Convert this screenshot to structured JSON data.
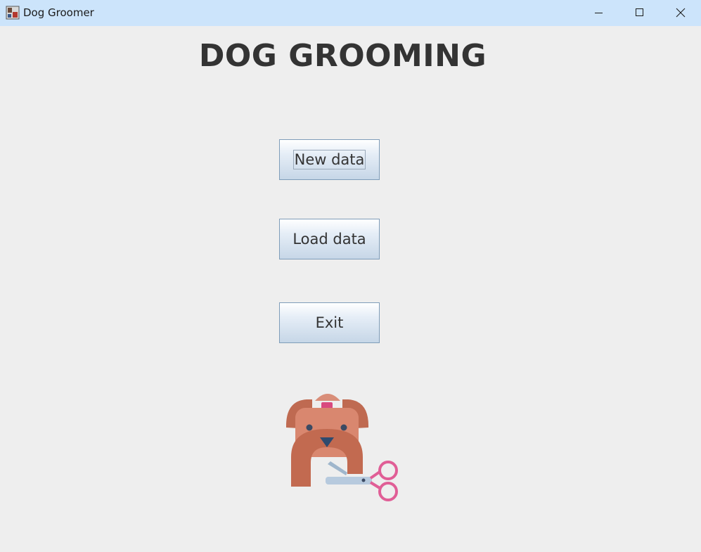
{
  "window": {
    "title": "Dog Groomer",
    "icons": {
      "app": "app-icon",
      "minimize": "minimize-icon",
      "maximize": "maximize-icon",
      "close": "close-icon"
    }
  },
  "main": {
    "heading": "DOG GROOMING",
    "buttons": {
      "new_data": "New data",
      "load_data": "Load data",
      "exit": "Exit"
    },
    "illustration": "dog-grooming-icon"
  },
  "colors": {
    "titlebar": "#cce4fb",
    "background": "#eeeeee",
    "button_border": "#7f9db9",
    "dog_fur": "#c56d54",
    "scissors": "#e05e96"
  }
}
